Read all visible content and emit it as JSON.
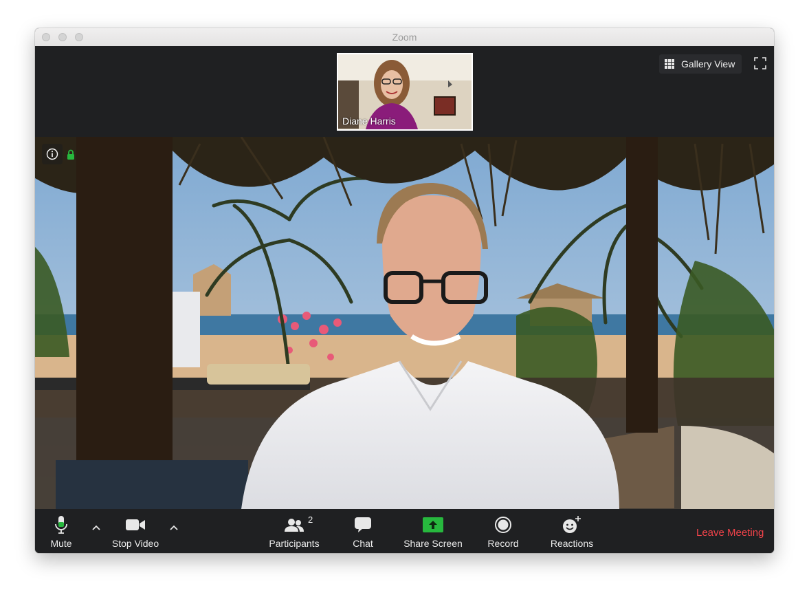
{
  "window": {
    "title": "Zoom"
  },
  "thumbnail": {
    "name": "Diane Harris"
  },
  "view_controls": {
    "gallery_label": "Gallery View"
  },
  "toolbar": {
    "mute_label": "Mute",
    "stop_video_label": "Stop Video",
    "participants_label": "Participants",
    "participants_count": "2",
    "chat_label": "Chat",
    "share_label": "Share Screen",
    "record_label": "Record",
    "reactions_label": "Reactions",
    "leave_label": "Leave Meeting"
  },
  "colors": {
    "accent_green": "#27b83e",
    "leave_red": "#f2434a",
    "toolbar_bg": "#1f2022"
  }
}
